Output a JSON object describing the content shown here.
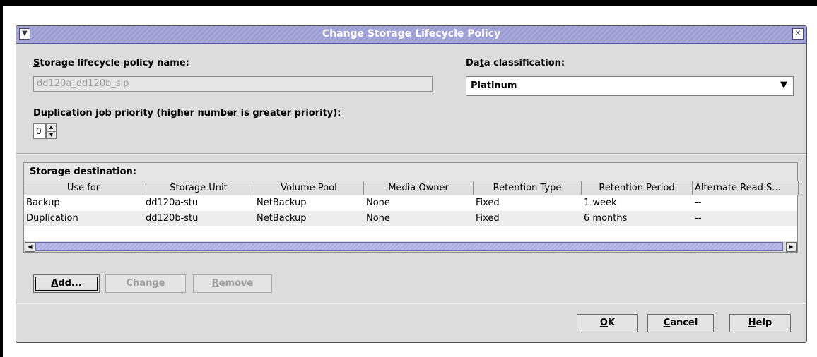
{
  "window": {
    "title": "Change Storage Lifecycle Policy",
    "menu_icon": "chevron-down-icon",
    "close_icon": "close-icon"
  },
  "policy_name": {
    "label": "torage lifecycle policy name:",
    "label_mnemonic": "S",
    "value": "dd120a_dd120b_slp"
  },
  "data_classification": {
    "label_pre": "Da",
    "label_mnemonic": "t",
    "label_post": "a classification:",
    "value": "Platinum"
  },
  "priority": {
    "label_pre": "Duplication ",
    "label_mnemonic": "j",
    "label_post": "ob priority (higher number is greater priority):",
    "value": "0"
  },
  "storage_destination": {
    "label": "Storage destination:",
    "columns": [
      "Use for",
      "Storage Unit",
      "Volume Pool",
      "Media Owner",
      "Retention Type",
      "Retention Period",
      "Alternate Read S..."
    ],
    "rows": [
      [
        "Backup",
        "dd120a-stu",
        "NetBackup",
        "None",
        "Fixed",
        "1 week",
        "--"
      ],
      [
        "Duplication",
        "dd120b-stu",
        "NetBackup",
        "None",
        "Fixed",
        "6 months",
        "--"
      ]
    ]
  },
  "actions": {
    "add": {
      "mnemonic": "A",
      "rest": "dd..."
    },
    "change": {
      "pre": "Chan",
      "mnemonic": "g",
      "post": "e"
    },
    "remove": {
      "mnemonic": "R",
      "rest": "emove"
    }
  },
  "footer": {
    "ok": {
      "mnemonic": "O",
      "rest": "K"
    },
    "cancel": {
      "mnemonic": "C",
      "rest": "ancel"
    },
    "help": {
      "mnemonic": "H",
      "rest": "elp"
    }
  },
  "colors": {
    "titlebar": "#9b9bd6",
    "window_bg": "#dcdcdc",
    "row_alt": "#ececec"
  }
}
